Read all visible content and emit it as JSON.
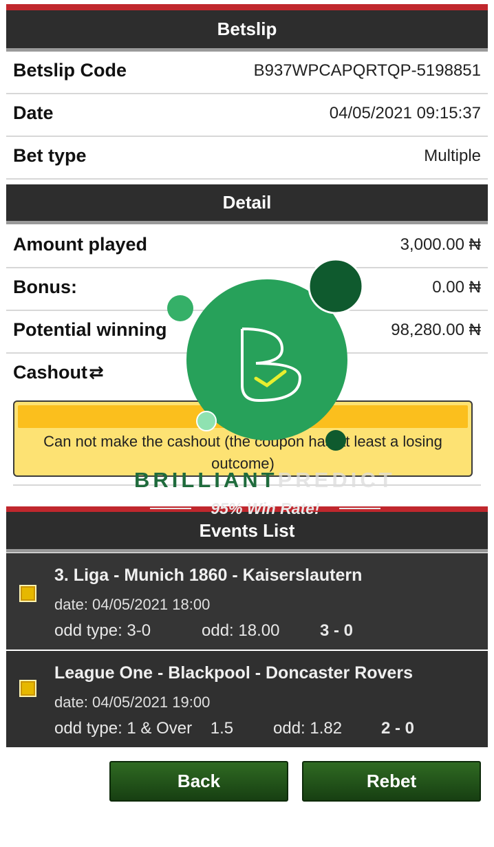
{
  "betslip": {
    "header": "Betslip",
    "rows": [
      {
        "label": "Betslip Code",
        "value": "B937WPCAPQRTQP-5198851"
      },
      {
        "label": "Date",
        "value": "04/05/2021 09:15:37"
      },
      {
        "label": "Bet type",
        "value": "Multiple"
      }
    ]
  },
  "detail": {
    "header": "Detail",
    "rows": [
      {
        "label": "Amount played",
        "value": "3,000.00 ₦"
      },
      {
        "label": "Bonus:",
        "value": "0.00 ₦"
      },
      {
        "label": "Potential winning",
        "value": "98,280.00 ₦"
      }
    ],
    "cashout_label": "Cashout",
    "cashout_icon": "refresh-arrows-icon",
    "cashout_message": "Can not make the cashout (the coupon has at least a losing outcome)"
  },
  "events": {
    "header": "Events List",
    "items": [
      {
        "title": "3. Liga - Munich 1860 - Kaiserslautern",
        "date": "date: 04/05/2021 18:00",
        "odd_type": "odd type: 3-0",
        "odd": "odd: 18.00",
        "score": "3 - 0"
      },
      {
        "title": "League One - Blackpool - Doncaster Rovers",
        "date": "date: 04/05/2021 19:00",
        "odd_type": "odd type: 1 & Over    1.5",
        "odd": "odd: 1.82",
        "score": "2 - 0"
      }
    ]
  },
  "buttons": {
    "back": "Back",
    "rebet": "Rebet"
  },
  "watermark": {
    "brand_strong": "BRILLIANT",
    "brand_faint": "PREDICT",
    "tagline": "95% Win Rate!"
  },
  "colors": {
    "accent_red": "#c0272d",
    "header_dark": "#2d2d2d",
    "button_green": "#2f6a22",
    "warning_yellow": "#fde273",
    "logo_green": "#2ea55b"
  }
}
